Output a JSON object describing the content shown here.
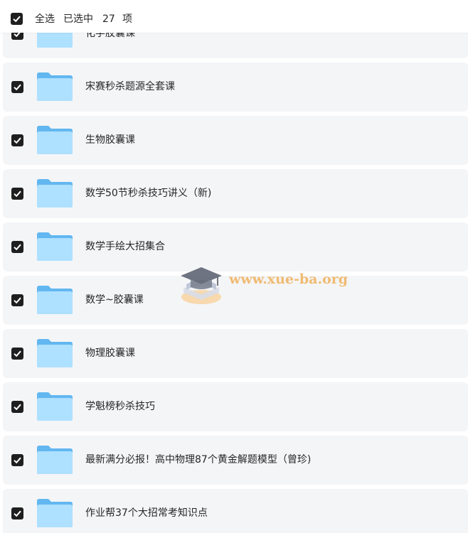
{
  "header": {
    "select_all_label": "全选",
    "selected_prefix": "已选中",
    "selected_count": "27",
    "selected_suffix": "项"
  },
  "items": [
    {
      "name": "化学胶囊课"
    },
    {
      "name": "宋赛秒杀题源全套课"
    },
    {
      "name": "生物胶囊课"
    },
    {
      "name": "数学50节秒杀技巧讲义（新)"
    },
    {
      "name": "数学手绘大招集合"
    },
    {
      "name": "数学~胶囊课"
    },
    {
      "name": "物理胶囊课"
    },
    {
      "name": "学魁榜秒杀技巧"
    },
    {
      "name": "最新满分必报！高中物理87个黄金解题模型（曾珍)"
    },
    {
      "name": "作业帮37个大招常考知识点"
    }
  ],
  "watermark": {
    "text": "www.xue-ba.org"
  },
  "colors": {
    "folder_light": "#aee0ff",
    "folder_dark": "#62b7f0",
    "row_bg": "#f4f5f7",
    "check_bg": "#1f1f1f"
  }
}
